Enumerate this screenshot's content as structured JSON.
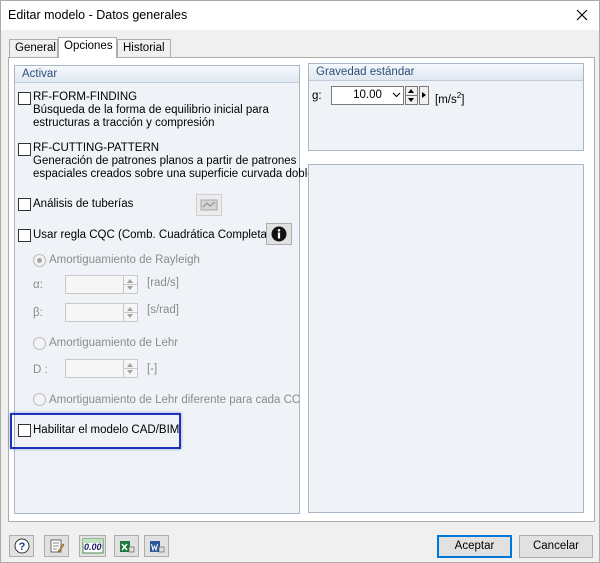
{
  "window": {
    "title": "Editar modelo - Datos generales",
    "close_icon": "close-icon"
  },
  "tabs": [
    {
      "label": "General"
    },
    {
      "label": "Opciones"
    },
    {
      "label": "Historial"
    }
  ],
  "activar": {
    "header": "Activar",
    "form_finding": {
      "label": "RF-FORM-FINDING",
      "desc1": "Búsqueda de la forma de equilibrio inicial para",
      "desc2": "estructuras a tracción y compresión"
    },
    "cutting_pattern": {
      "label": "RF-CUTTING-PATTERN",
      "desc1": "Generación de patrones planos a partir de patrones",
      "desc2": "espaciales creados sobre una superficie curvada doble"
    },
    "tuberias": {
      "label": "Análisis de tuberías"
    },
    "cqc": {
      "label": "Usar regla CQC (Comb. Cuadrática Completa)"
    },
    "rayleigh": {
      "label": "Amortiguamiento de Rayleigh",
      "alpha_label": "α:",
      "alpha_unit": "[rad/s]",
      "beta_label": "β:",
      "beta_unit": "[s/rad]"
    },
    "lehr": {
      "label": "Amortiguamiento de Lehr",
      "d_label": "D :",
      "d_unit": "[-]"
    },
    "lehr_cc": {
      "label": "Amortiguamiento de Lehr diferente para cada CC"
    },
    "cad_bim": {
      "label": "Habilitar el modelo CAD/BIM"
    }
  },
  "gravedad": {
    "header": "Gravedad estándar",
    "g_label": "g:",
    "value": "10.00",
    "unit_prefix": "[m/s",
    "unit_sup": "2",
    "unit_suffix": "]"
  },
  "footer": {
    "accept": "Aceptar",
    "cancel": "Cancelar",
    "zero_label": "0.00"
  },
  "colors": {
    "highlight": "#1f33b8",
    "group_header_text": "#2d4e7b",
    "default_button_border": "#0078d7"
  }
}
